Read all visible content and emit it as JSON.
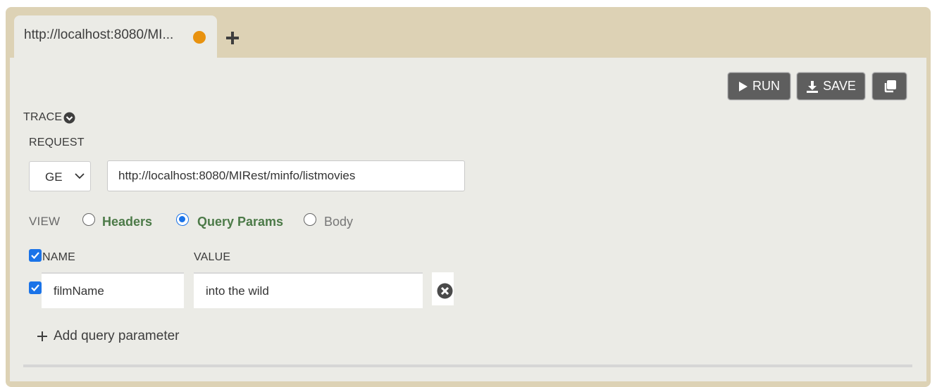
{
  "tab": {
    "title": "http://localhost:8080/MI...",
    "status_color": "#e8920f"
  },
  "toolbar": {
    "run_label": "RUN",
    "save_label": "SAVE"
  },
  "trace": {
    "label": "TRACE"
  },
  "request": {
    "section_label": "REQUEST",
    "method": "GE",
    "url": "http://localhost:8080/MIRest/minfo/listmovies"
  },
  "view": {
    "label": "VIEW",
    "options": [
      {
        "label": "Headers",
        "selected": false
      },
      {
        "label": "Query Params",
        "selected": true
      },
      {
        "label": "Body",
        "selected": false
      }
    ]
  },
  "params": {
    "name_header": "NAME",
    "value_header": "VALUE",
    "rows": [
      {
        "name": "filmName",
        "value": "into the wild",
        "enabled": true
      }
    ],
    "add_label": "Add query parameter"
  },
  "colors": {
    "frame": "#ddd2b5",
    "panel": "#ebebe6",
    "button": "#5e5e5e",
    "accent_green": "#4c7a48",
    "accent_blue": "#1a73e8"
  }
}
